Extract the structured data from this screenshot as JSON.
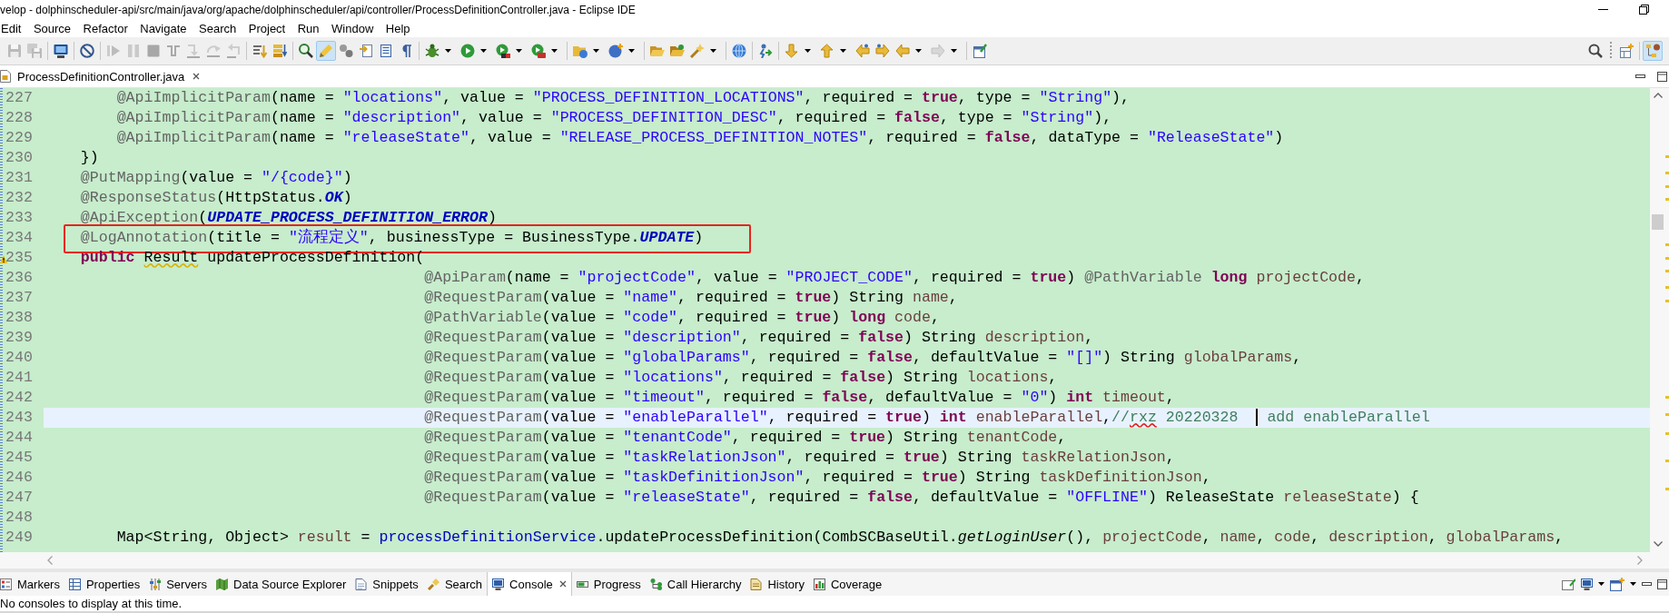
{
  "window": {
    "title": "velop - dolphinscheduler-api/src/main/java/org/apache/dolphinscheduler/api/controller/ProcessDefinitionController.java - Eclipse IDE"
  },
  "menu": [
    {
      "label": "Edit"
    },
    {
      "label": "Source"
    },
    {
      "label": "Refactor"
    },
    {
      "label": "Navigate"
    },
    {
      "label": "Search"
    },
    {
      "label": "Project"
    },
    {
      "label": "Run"
    },
    {
      "label": "Window"
    },
    {
      "label": "Help"
    }
  ],
  "toolbar": {
    "groups": [
      [
        {
          "disabled": true,
          "pressed": false,
          "dropdown": false
        },
        {
          "disabled": true,
          "pressed": false,
          "dropdown": false
        }
      ],
      [
        {
          "disabled": false,
          "pressed": false,
          "dropdown": false
        }
      ],
      [
        {
          "disabled": false,
          "pressed": false,
          "dropdown": false
        }
      ],
      [
        {
          "disabled": true,
          "pressed": false,
          "dropdown": false
        },
        {
          "disabled": true,
          "pressed": false,
          "dropdown": false
        },
        {
          "disabled": true,
          "pressed": false,
          "dropdown": false
        },
        {
          "disabled": true,
          "pressed": false,
          "dropdown": false
        },
        {
          "disabled": true,
          "pressed": false,
          "dropdown": false
        },
        {
          "disabled": true,
          "pressed": false,
          "dropdown": false
        },
        {
          "disabled": true,
          "pressed": false,
          "dropdown": false
        }
      ],
      [
        {
          "disabled": false,
          "pressed": false,
          "dropdown": false
        },
        {
          "disabled": false,
          "pressed": false,
          "dropdown": false
        }
      ],
      [
        {
          "disabled": false,
          "pressed": false,
          "dropdown": false
        },
        {
          "disabled": false,
          "pressed": true,
          "dropdown": false
        },
        {
          "disabled": false,
          "pressed": false,
          "dropdown": false
        },
        {
          "disabled": false,
          "pressed": false,
          "dropdown": false
        },
        {
          "disabled": false,
          "pressed": false,
          "dropdown": false
        },
        {
          "disabled": false,
          "pressed": false,
          "dropdown": false
        }
      ],
      [
        {
          "disabled": false,
          "pressed": false,
          "dropdown": true
        },
        {
          "disabled": false,
          "pressed": false,
          "dropdown": true
        },
        {
          "disabled": false,
          "pressed": false,
          "dropdown": true
        },
        {
          "disabled": false,
          "pressed": false,
          "dropdown": true
        }
      ],
      [
        {
          "disabled": false,
          "pressed": false,
          "dropdown": true
        },
        {
          "disabled": false,
          "pressed": false,
          "dropdown": true
        }
      ],
      [
        {
          "disabled": false,
          "pressed": false,
          "dropdown": false
        },
        {
          "disabled": false,
          "pressed": false,
          "dropdown": false
        },
        {
          "disabled": false,
          "pressed": false,
          "dropdown": true
        }
      ],
      [
        {
          "disabled": false,
          "pressed": false,
          "dropdown": false
        }
      ],
      [
        {
          "disabled": false,
          "pressed": false,
          "dropdown": false
        }
      ],
      [
        {
          "disabled": false,
          "pressed": false,
          "dropdown": true
        },
        {
          "disabled": false,
          "pressed": false,
          "dropdown": true
        },
        {
          "disabled": false,
          "pressed": false,
          "dropdown": false
        },
        {
          "disabled": false,
          "pressed": false,
          "dropdown": false
        },
        {
          "disabled": false,
          "pressed": false,
          "dropdown": true
        },
        {
          "disabled": true,
          "pressed": false,
          "dropdown": true
        }
      ],
      [
        {
          "disabled": false,
          "pressed": false,
          "dropdown": false
        }
      ]
    ]
  },
  "perspective_bar": [
    {
      "pressed": false
    },
    {
      "pressed": false
    },
    {
      "pressed": true
    }
  ],
  "editor_tabs": [
    {
      "label": "ProcessDefinitionController.java",
      "selected": true
    }
  ],
  "editor": {
    "lines": [
      {
        "kind": "block",
        "children": [
          {
            "kind": "block",
            "number": "227",
            "current": false,
            "framed": false,
            "warning": false,
            "tokens": [
              {
                "text": "@ApiImplicitParam",
                "kind": "annotation"
              },
              {
                "text": "(name = ",
                "kind": "plain"
              },
              {
                "text": "\"locations\"",
                "kind": "string"
              },
              {
                "text": ", value = ",
                "kind": "plain"
              },
              {
                "text": "\"PROCESS_DEFINITION_LOCATIONS\"",
                "kind": "string"
              },
              {
                "text": ", required = ",
                "kind": "plain"
              },
              {
                "text": "true",
                "kind": "keyword"
              },
              {
                "text": ", type = ",
                "kind": "plain"
              },
              {
                "text": "\"String\"",
                "kind": "string"
              },
              {
                "text": "),",
                "kind": "plain"
              }
            ]
          },
          {
            "kind": "block",
            "number": "228",
            "current": false,
            "framed": false,
            "warning": false,
            "tokens": [
              {
                "text": "@ApiImplicitParam",
                "kind": "annotation"
              },
              {
                "text": "(name = ",
                "kind": "plain"
              },
              {
                "text": "\"description\"",
                "kind": "string"
              },
              {
                "text": ", value = ",
                "kind": "plain"
              },
              {
                "text": "\"PROCESS_DEFINITION_DESC\"",
                "kind": "string"
              },
              {
                "text": ", required = ",
                "kind": "plain"
              },
              {
                "text": "false",
                "kind": "keyword"
              },
              {
                "text": ", type = ",
                "kind": "plain"
              },
              {
                "text": "\"String\"",
                "kind": "string"
              },
              {
                "text": "),",
                "kind": "plain"
              }
            ]
          },
          {
            "kind": "block",
            "number": "229",
            "current": false,
            "framed": false,
            "warning": false,
            "tokens": [
              {
                "text": "@ApiImplicitParam",
                "kind": "annotation"
              },
              {
                "text": "(name = ",
                "kind": "plain"
              },
              {
                "text": "\"releaseState\"",
                "kind": "string"
              },
              {
                "text": ", value = ",
                "kind": "plain"
              },
              {
                "text": "\"RELEASE_PROCESS_DEFINITION_NOTES\"",
                "kind": "string"
              },
              {
                "text": ", required = ",
                "kind": "plain"
              },
              {
                "text": "false",
                "kind": "keyword"
              },
              {
                "text": ", dataType = ",
                "kind": "plain"
              },
              {
                "text": "\"ReleaseState\"",
                "kind": "string"
              },
              {
                "text": ")",
                "kind": "plain"
              }
            ]
          }
        ]
      },
      {
        "kind": "block",
        "number": "230",
        "current": false,
        "framed": false,
        "warning": false,
        "tokens": [
          {
            "text": "})",
            "kind": "plain"
          }
        ]
      },
      {
        "kind": "block",
        "number": "231",
        "current": false,
        "framed": false,
        "warning": false,
        "tokens": [
          {
            "text": "@PutMapping",
            "kind": "annotation"
          },
          {
            "text": "(value = ",
            "kind": "plain"
          },
          {
            "text": "\"/{code}\"",
            "kind": "string"
          },
          {
            "text": ")",
            "kind": "plain"
          }
        ]
      },
      {
        "kind": "block",
        "number": "232",
        "current": false,
        "framed": false,
        "warning": false,
        "tokens": [
          {
            "text": "@ResponseStatus",
            "kind": "annotation"
          },
          {
            "text": "(HttpStatus.",
            "kind": "plain"
          },
          {
            "text": "OK",
            "kind": "constant"
          },
          {
            "text": ")",
            "kind": "plain"
          }
        ]
      },
      {
        "kind": "block",
        "number": "233",
        "current": false,
        "framed": false,
        "warning": false,
        "tokens": [
          {
            "text": "@ApiException",
            "kind": "annotation"
          },
          {
            "text": "(",
            "kind": "plain"
          },
          {
            "text": "UPDATE_PROCESS_DEFINITION_ERROR",
            "kind": "constant"
          },
          {
            "text": ")",
            "kind": "plain"
          }
        ]
      },
      {
        "kind": "block",
        "number": "234",
        "current": false,
        "framed": true,
        "warning": false,
        "tokens": [
          {
            "text": "@LogAnnotation",
            "kind": "annotation"
          },
          {
            "text": "(title = ",
            "kind": "plain"
          },
          {
            "text": "\"流程定义\"",
            "kind": "string"
          },
          {
            "text": ", businessType = BusinessType.",
            "kind": "plain"
          },
          {
            "text": "UPDATE",
            "kind": "constant"
          },
          {
            "text": ")",
            "kind": "plain"
          }
        ]
      },
      {
        "kind": "block",
        "number": "235",
        "current": false,
        "framed": false,
        "warning": true,
        "tokens": [
          {
            "text": "public ",
            "kind": "keyword"
          },
          {
            "text": "Result",
            "kind": "flagged"
          },
          {
            "text": " updateProcessDefinition(",
            "kind": "plain"
          }
        ],
        "children": [
          {
            "kind": "continuation",
            "number": "236",
            "current": false,
            "framed": false,
            "warning": false,
            "tokens": [
              {
                "text": "@ApiParam",
                "kind": "annotation"
              },
              {
                "text": "(name = ",
                "kind": "plain"
              },
              {
                "text": "\"projectCode\"",
                "kind": "string"
              },
              {
                "text": ", value = ",
                "kind": "plain"
              },
              {
                "text": "\"PROJECT_CODE\"",
                "kind": "string"
              },
              {
                "text": ", required = ",
                "kind": "plain"
              },
              {
                "text": "true",
                "kind": "keyword"
              },
              {
                "text": ") ",
                "kind": "plain"
              },
              {
                "text": "@PathVariable ",
                "kind": "annotation"
              },
              {
                "text": "long ",
                "kind": "keyword"
              },
              {
                "text": "projectCode",
                "kind": "variable"
              },
              {
                "text": ",",
                "kind": "plain"
              }
            ]
          },
          {
            "kind": "continuation",
            "number": "237",
            "current": false,
            "framed": false,
            "warning": false,
            "tokens": [
              {
                "text": "@RequestParam",
                "kind": "annotation"
              },
              {
                "text": "(value = ",
                "kind": "plain"
              },
              {
                "text": "\"name\"",
                "kind": "string"
              },
              {
                "text": ", required = ",
                "kind": "plain"
              },
              {
                "text": "true",
                "kind": "keyword"
              },
              {
                "text": ") String ",
                "kind": "plain"
              },
              {
                "text": "name",
                "kind": "variable"
              },
              {
                "text": ",",
                "kind": "plain"
              }
            ]
          },
          {
            "kind": "continuation",
            "number": "238",
            "current": false,
            "framed": false,
            "warning": false,
            "tokens": [
              {
                "text": "@PathVariable",
                "kind": "annotation"
              },
              {
                "text": "(value = ",
                "kind": "plain"
              },
              {
                "text": "\"code\"",
                "kind": "string"
              },
              {
                "text": ", required = ",
                "kind": "plain"
              },
              {
                "text": "true",
                "kind": "keyword"
              },
              {
                "text": ") ",
                "kind": "plain"
              },
              {
                "text": "long ",
                "kind": "keyword"
              },
              {
                "text": "code",
                "kind": "variable"
              },
              {
                "text": ",",
                "kind": "plain"
              }
            ]
          },
          {
            "kind": "continuation",
            "number": "239",
            "current": false,
            "framed": false,
            "warning": false,
            "tokens": [
              {
                "text": "@RequestParam",
                "kind": "annotation"
              },
              {
                "text": "(value = ",
                "kind": "plain"
              },
              {
                "text": "\"description\"",
                "kind": "string"
              },
              {
                "text": ", required = ",
                "kind": "plain"
              },
              {
                "text": "false",
                "kind": "keyword"
              },
              {
                "text": ") String ",
                "kind": "plain"
              },
              {
                "text": "description",
                "kind": "variable"
              },
              {
                "text": ",",
                "kind": "plain"
              }
            ]
          },
          {
            "kind": "continuation",
            "number": "240",
            "current": false,
            "framed": false,
            "warning": false,
            "tokens": [
              {
                "text": "@RequestParam",
                "kind": "annotation"
              },
              {
                "text": "(value = ",
                "kind": "plain"
              },
              {
                "text": "\"globalParams\"",
                "kind": "string"
              },
              {
                "text": ", required = ",
                "kind": "plain"
              },
              {
                "text": "false",
                "kind": "keyword"
              },
              {
                "text": ", defaultValue = ",
                "kind": "plain"
              },
              {
                "text": "\"[]\"",
                "kind": "string"
              },
              {
                "text": ") String ",
                "kind": "plain"
              },
              {
                "text": "globalParams",
                "kind": "variable"
              },
              {
                "text": ",",
                "kind": "plain"
              }
            ]
          },
          {
            "kind": "continuation",
            "number": "241",
            "current": false,
            "framed": false,
            "warning": false,
            "tokens": [
              {
                "text": "@RequestParam",
                "kind": "annotation"
              },
              {
                "text": "(value = ",
                "kind": "plain"
              },
              {
                "text": "\"locations\"",
                "kind": "string"
              },
              {
                "text": ", required = ",
                "kind": "plain"
              },
              {
                "text": "false",
                "kind": "keyword"
              },
              {
                "text": ") String ",
                "kind": "plain"
              },
              {
                "text": "locations",
                "kind": "variable"
              },
              {
                "text": ",",
                "kind": "plain"
              }
            ]
          },
          {
            "kind": "continuation",
            "number": "242",
            "current": false,
            "framed": false,
            "warning": false,
            "tokens": [
              {
                "text": "@RequestParam",
                "kind": "annotation"
              },
              {
                "text": "(value = ",
                "kind": "plain"
              },
              {
                "text": "\"timeout\"",
                "kind": "string"
              },
              {
                "text": ", required = ",
                "kind": "plain"
              },
              {
                "text": "false",
                "kind": "keyword"
              },
              {
                "text": ", defaultValue = ",
                "kind": "plain"
              },
              {
                "text": "\"0\"",
                "kind": "string"
              },
              {
                "text": ") ",
                "kind": "plain"
              },
              {
                "text": "int ",
                "kind": "keyword"
              },
              {
                "text": "timeout",
                "kind": "variable"
              },
              {
                "text": ",",
                "kind": "plain"
              }
            ]
          },
          {
            "kind": "continuation",
            "number": "243",
            "current": true,
            "framed": false,
            "warning": false,
            "tokens": [
              {
                "text": "@RequestParam",
                "kind": "annotation"
              },
              {
                "text": "(value = ",
                "kind": "plain"
              },
              {
                "text": "\"enableParallel\"",
                "kind": "string"
              },
              {
                "text": ", required = ",
                "kind": "plain"
              },
              {
                "text": "true",
                "kind": "keyword"
              },
              {
                "text": ") ",
                "kind": "plain"
              },
              {
                "text": "int ",
                "kind": "keyword"
              },
              {
                "text": "enableParallel",
                "kind": "variable"
              },
              {
                "text": ",",
                "kind": "plain"
              },
              {
                "text": "//",
                "kind": "comment"
              },
              {
                "text": "rxz",
                "kind": "misspelled"
              },
              {
                "text": " 20220328  ",
                "kind": "comment"
              },
              {
                "kind": "cursor"
              },
              {
                "text": " add enableParallel",
                "kind": "comment"
              }
            ]
          },
          {
            "kind": "continuation",
            "number": "244",
            "current": false,
            "framed": false,
            "warning": false,
            "tokens": [
              {
                "text": "@RequestParam",
                "kind": "annotation"
              },
              {
                "text": "(value = ",
                "kind": "plain"
              },
              {
                "text": "\"tenantCode\"",
                "kind": "string"
              },
              {
                "text": ", required = ",
                "kind": "plain"
              },
              {
                "text": "true",
                "kind": "keyword"
              },
              {
                "text": ") String ",
                "kind": "plain"
              },
              {
                "text": "tenantCode",
                "kind": "variable"
              },
              {
                "text": ",",
                "kind": "plain"
              }
            ]
          },
          {
            "kind": "continuation",
            "number": "245",
            "current": false,
            "framed": false,
            "warning": false,
            "tokens": [
              {
                "text": "@RequestParam",
                "kind": "annotation"
              },
              {
                "text": "(value = ",
                "kind": "plain"
              },
              {
                "text": "\"taskRelationJson\"",
                "kind": "string"
              },
              {
                "text": ", required = ",
                "kind": "plain"
              },
              {
                "text": "true",
                "kind": "keyword"
              },
              {
                "text": ") String ",
                "kind": "plain"
              },
              {
                "text": "taskRelationJson",
                "kind": "variable"
              },
              {
                "text": ",",
                "kind": "plain"
              }
            ]
          },
          {
            "kind": "continuation",
            "number": "246",
            "current": false,
            "framed": false,
            "warning": false,
            "tokens": [
              {
                "text": "@RequestParam",
                "kind": "annotation"
              },
              {
                "text": "(value = ",
                "kind": "plain"
              },
              {
                "text": "\"taskDefinitionJson\"",
                "kind": "string"
              },
              {
                "text": ", required = ",
                "kind": "plain"
              },
              {
                "text": "true",
                "kind": "keyword"
              },
              {
                "text": ") String ",
                "kind": "plain"
              },
              {
                "text": "taskDefinitionJson",
                "kind": "variable"
              },
              {
                "text": ",",
                "kind": "plain"
              }
            ]
          },
          {
            "kind": "continuation",
            "number": "247",
            "current": false,
            "framed": false,
            "warning": false,
            "tokens": [
              {
                "text": "@RequestParam",
                "kind": "annotation"
              },
              {
                "text": "(value = ",
                "kind": "plain"
              },
              {
                "text": "\"releaseState\"",
                "kind": "string"
              },
              {
                "text": ", required = ",
                "kind": "plain"
              },
              {
                "text": "false",
                "kind": "keyword"
              },
              {
                "text": ", defaultValue = ",
                "kind": "plain"
              },
              {
                "text": "\"OFFLINE\"",
                "kind": "string"
              },
              {
                "text": ") ReleaseState ",
                "kind": "plain"
              },
              {
                "text": "releaseState",
                "kind": "variable"
              },
              {
                "text": ") {",
                "kind": "plain"
              }
            ]
          },
          {
            "kind": "block",
            "number": "248",
            "current": false,
            "framed": false,
            "warning": false
          },
          {
            "kind": "block",
            "number": "249",
            "current": false,
            "framed": false,
            "warning": false,
            "tokens": [
              {
                "text": "Map<String, Object> ",
                "kind": "plain"
              },
              {
                "text": "result",
                "kind": "variable"
              },
              {
                "text": " = ",
                "kind": "plain"
              },
              {
                "text": "processDefinitionService",
                "kind": "field"
              },
              {
                "text": ".updateProcessDefinition(CombSCBaseUtil.",
                "kind": "plain"
              },
              {
                "text": "getLoginUser",
                "kind": "static-method"
              },
              {
                "text": "(), ",
                "kind": "plain"
              },
              {
                "text": "projectCode",
                "kind": "variable"
              },
              {
                "text": ", ",
                "kind": "plain"
              },
              {
                "text": "name",
                "kind": "variable"
              },
              {
                "text": ", ",
                "kind": "plain"
              },
              {
                "text": "code",
                "kind": "variable"
              },
              {
                "text": ", ",
                "kind": "plain"
              },
              {
                "text": "description",
                "kind": "variable"
              },
              {
                "text": ", ",
                "kind": "plain"
              },
              {
                "text": "globalParams",
                "kind": "variable"
              },
              {
                "text": ",",
                "kind": "plain"
              }
            ]
          }
        ]
      }
    ]
  },
  "bottom_panel": {
    "tabs": [
      {
        "label": "Markers",
        "selected": false
      },
      {
        "label": "Properties",
        "selected": false
      },
      {
        "label": "Servers",
        "selected": false
      },
      {
        "label": "Data Source Explorer",
        "selected": false
      },
      {
        "label": "Snippets",
        "selected": false
      },
      {
        "label": "Search",
        "selected": false
      },
      {
        "label": "Console",
        "selected": true
      },
      {
        "label": "Progress",
        "selected": false
      },
      {
        "label": "Call Hierarchy",
        "selected": false
      },
      {
        "label": "History",
        "selected": false
      },
      {
        "label": "Coverage",
        "selected": false
      }
    ],
    "message": "No consoles to display at this time."
  }
}
